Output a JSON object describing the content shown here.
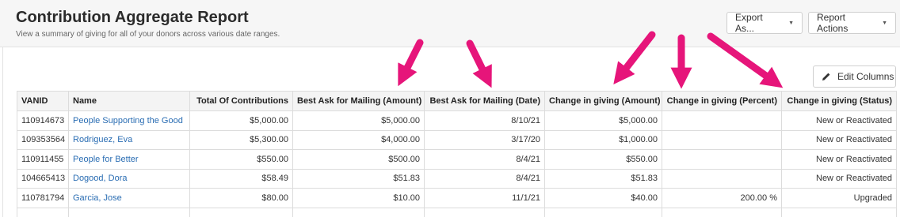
{
  "header": {
    "title": "Contribution Aggregate Report",
    "subtitle": "View a summary of giving for all of your donors across various date ranges.",
    "export_label": "Export As...",
    "actions_label": "Report Actions"
  },
  "toolbar": {
    "edit_columns_label": "Edit Columns"
  },
  "table": {
    "columns": [
      "VANID",
      "Name",
      "Total Of Contributions",
      "Best Ask for Mailing (Amount)",
      "Best Ask for Mailing (Date)",
      "Change in giving (Amount)",
      "Change in giving (Percent)",
      "Change in giving (Status)"
    ],
    "rows": [
      {
        "vanid": "110914673",
        "name": "People Supporting the Good",
        "total": "$5,000.00",
        "ask_amount": "$5,000.00",
        "ask_date": "8/10/21",
        "change_amount": "$5,000.00",
        "change_percent": "",
        "status": "New or Reactivated"
      },
      {
        "vanid": "109353564",
        "name": "Rodriguez, Eva",
        "total": "$5,300.00",
        "ask_amount": "$4,000.00",
        "ask_date": "3/17/20",
        "change_amount": "$1,000.00",
        "change_percent": "",
        "status": "New or Reactivated"
      },
      {
        "vanid": "110911455",
        "name": "People for Better",
        "total": "$550.00",
        "ask_amount": "$500.00",
        "ask_date": "8/4/21",
        "change_amount": "$550.00",
        "change_percent": "",
        "status": "New or Reactivated"
      },
      {
        "vanid": "104665413",
        "name": "Dogood, Dora",
        "total": "$58.49",
        "ask_amount": "$51.83",
        "ask_date": "8/4/21",
        "change_amount": "$51.83",
        "change_percent": "",
        "status": "New or Reactivated"
      },
      {
        "vanid": "110781794",
        "name": "Garcia, Jose",
        "total": "$80.00",
        "ask_amount": "$10.00",
        "ask_date": "11/1/21",
        "change_amount": "$40.00",
        "change_percent": "200.00 %",
        "status": "Upgraded"
      }
    ]
  },
  "annotation": {
    "arrow_color": "#e6157a"
  }
}
